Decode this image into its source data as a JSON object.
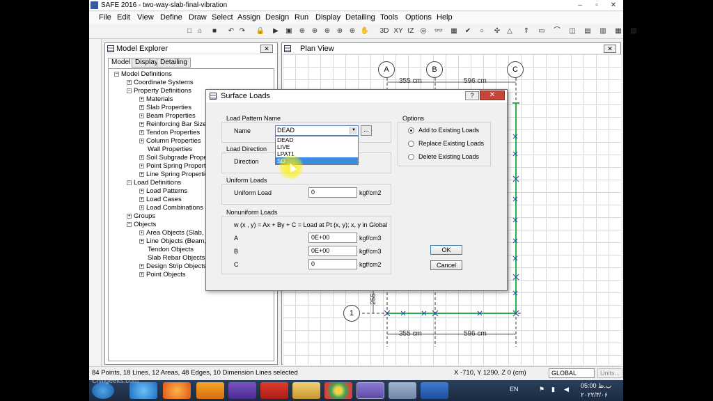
{
  "window": {
    "title": "SAFE 2016 - two-way-slab-final-vibration",
    "controls": [
      "–",
      "▫",
      "✕"
    ]
  },
  "menu": [
    "File",
    "Edit",
    "View",
    "Define",
    "Draw",
    "Select",
    "Assign",
    "Design",
    "Run",
    "Display",
    "Detailing",
    "Tools",
    "Options",
    "Help"
  ],
  "toolbar": {
    "tools": [
      "□",
      "⌂",
      "■",
      "↶",
      "↷",
      "🔒",
      "▶",
      "▣",
      "⊕",
      "⊕",
      "⊕",
      "⊕",
      "⊕",
      "✋",
      "3D",
      "XY",
      "tZ",
      "◎",
      "👓",
      "▦",
      "✔",
      "○",
      "✣",
      "△",
      "⇑",
      "▭",
      "⌒",
      "◫",
      "▤",
      "▥",
      "▦",
      "▧"
    ]
  },
  "vtools": [
    "↖",
    "↕",
    "▭",
    "■",
    "▣",
    "◉",
    "╲",
    "▨",
    "▦",
    "▩",
    "╱",
    "▬",
    "—",
    "〜",
    "⊥",
    "⊕",
    "┼",
    "all",
    "ps",
    "clr",
    "⊠"
  ],
  "model_explorer": {
    "title": "Model Explorer",
    "tabs": [
      "Model",
      "Display",
      "Detailing"
    ],
    "tree": [
      {
        "label": "Model Definitions",
        "indent": 0,
        "sign": "−"
      },
      {
        "label": "Coordinate Systems",
        "indent": 1,
        "sign": "+"
      },
      {
        "label": "Property Definitions",
        "indent": 1,
        "sign": "−"
      },
      {
        "label": "Materials",
        "indent": 2,
        "sign": "+"
      },
      {
        "label": "Slab Properties",
        "indent": 2,
        "sign": "+"
      },
      {
        "label": "Beam Properties",
        "indent": 2,
        "sign": "+"
      },
      {
        "label": "Reinforcing Bar Sizes",
        "indent": 2,
        "sign": "+"
      },
      {
        "label": "Tendon Properties",
        "indent": 2,
        "sign": "+"
      },
      {
        "label": "Column Properties",
        "indent": 2,
        "sign": "+"
      },
      {
        "label": "Wall Properties",
        "indent": 2,
        "sign": ""
      },
      {
        "label": "Soil Subgrade Properties",
        "indent": 2,
        "sign": "+"
      },
      {
        "label": "Point Spring Properties",
        "indent": 2,
        "sign": "+"
      },
      {
        "label": "Line Spring Properties",
        "indent": 2,
        "sign": "+"
      },
      {
        "label": "Load Definitions",
        "indent": 1,
        "sign": "−"
      },
      {
        "label": "Load Patterns",
        "indent": 2,
        "sign": "+"
      },
      {
        "label": "Load Cases",
        "indent": 2,
        "sign": "+"
      },
      {
        "label": "Load Combinations",
        "indent": 2,
        "sign": "+"
      },
      {
        "label": "Groups",
        "indent": 1,
        "sign": "+"
      },
      {
        "label": "Objects",
        "indent": 1,
        "sign": "−"
      },
      {
        "label": "Area Objects (Slab, Wa",
        "indent": 2,
        "sign": "+"
      },
      {
        "label": "Line Objects (Beam, Co",
        "indent": 2,
        "sign": "+"
      },
      {
        "label": "Tendon Objects",
        "indent": 2,
        "sign": ""
      },
      {
        "label": "Slab Rebar Objects",
        "indent": 2,
        "sign": ""
      },
      {
        "label": "Design Strip Objects",
        "indent": 2,
        "sign": "+"
      },
      {
        "label": "Point Objects",
        "indent": 2,
        "sign": "+"
      }
    ],
    "close": "✕"
  },
  "plan_view": {
    "title": "Plan View",
    "close": "✕",
    "grid_labels": [
      "A",
      "B",
      "C",
      "1"
    ],
    "dims": [
      "355 cm",
      "596 cm",
      "355 cm",
      "596 cm",
      "255"
    ]
  },
  "dialog": {
    "title": "Surface Loads",
    "help": "?",
    "close": "✕",
    "load_pattern_group": "Load Pattern Name",
    "name_label": "Name",
    "name_value": "DEAD",
    "dots": "...",
    "dropdown_options": [
      "DEAD",
      "LIVE",
      "LPAT1",
      "SD"
    ],
    "dropdown_selected": "SD",
    "load_direction_group": "Load Direction",
    "direction_label": "Direction",
    "uniform_group": "Uniform Loads",
    "uniform_label": "Uniform Load",
    "uniform_value": "0",
    "uniform_unit": "kgf/cm2",
    "nonuniform_group": "Nonuniform Loads",
    "formula": "w (x , y)  =  Ax + By + C  =  Load at Pt (x, y); x, y in Global",
    "a_label": "A",
    "a_value": "0E+00",
    "a_unit": "kgf/cm3",
    "b_label": "B",
    "b_value": "0E+00",
    "b_unit": "kgf/cm3",
    "c_label": "C",
    "c_value": "0",
    "c_unit": "kgf/cm2",
    "options_group": "Options",
    "options": [
      "Add to Existing Loads",
      "Replace Existing Loads",
      "Delete Existing Loads"
    ],
    "option_selected": "Add to Existing Loads",
    "ok": "OK",
    "cancel": "Cancel"
  },
  "status": {
    "left": "84 Points, 18 Lines, 12 Areas, 48 Edges, 10 Dimension Lines selected",
    "coords": "X -710,  Y 1290,  Z 0  (cm)",
    "coord_system": "GLOBAL",
    "units": "Units..."
  },
  "taskbar": {
    "lang": "EN",
    "time": "05:00 ب.ظ",
    "date": "۲۰۲۲/۳/۰۶",
    "watermark": "Civilgeeks.com"
  }
}
